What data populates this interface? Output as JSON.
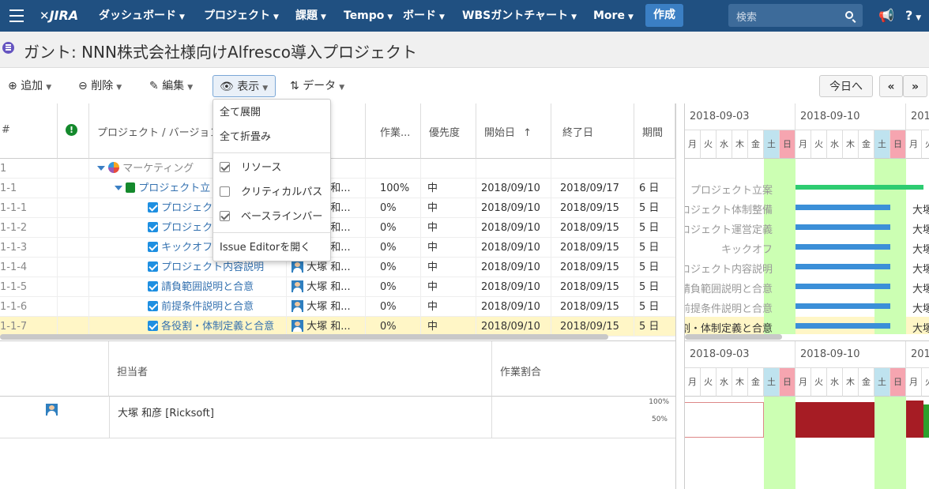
{
  "nav": {
    "logo": "JIRA",
    "items": [
      "ダッシュボード",
      "プロジェクト",
      "課題",
      "Tempo",
      "ボード",
      "WBSガントチャート",
      "More"
    ],
    "create": "作成",
    "search_placeholder": "検索"
  },
  "page": {
    "title": "ガント: NNN株式会社様向けAlfresco導入プロジェクト"
  },
  "toolbar": {
    "add": "追加",
    "delete": "削除",
    "edit": "編集",
    "view": "表示",
    "data": "データ",
    "today": "今日へ",
    "prev": "«",
    "next": "»"
  },
  "menu": {
    "expand_all": "全て展開",
    "collapse_all": "全て折畳み",
    "resource": "リソース",
    "critical_path": "クリティカルパス",
    "baseline": "ベースラインバー",
    "issue_editor": "Issue Editorを開く"
  },
  "grid": {
    "headers": {
      "id": "#",
      "project": "プロジェクト / バージョン",
      "work": "作業...",
      "priority": "優先度",
      "start": "開始日",
      "sort_arrow": "↑",
      "end": "終了日",
      "duration": "期間"
    },
    "rows": [
      {
        "id": "1",
        "name": "マーケティング",
        "assignee": "",
        "work": "",
        "priority": "",
        "start": "",
        "end": "",
        "duration": ""
      },
      {
        "id": "1-1",
        "name": "プロジェクト立",
        "assignee": "大塚 和...",
        "work": "100%",
        "priority": "中",
        "start": "2018/09/10",
        "end": "2018/09/17",
        "duration": "6 日"
      },
      {
        "id": "1-1-1",
        "name": "プロジェク",
        "assignee": "大塚 和...",
        "work": "0%",
        "priority": "中",
        "start": "2018/09/10",
        "end": "2018/09/15",
        "duration": "5 日"
      },
      {
        "id": "1-1-2",
        "name": "プロジェク",
        "assignee": "大塚 和...",
        "work": "0%",
        "priority": "中",
        "start": "2018/09/10",
        "end": "2018/09/15",
        "duration": "5 日"
      },
      {
        "id": "1-1-3",
        "name": "キックオフ",
        "assignee": "大塚 和...",
        "work": "0%",
        "priority": "中",
        "start": "2018/09/10",
        "end": "2018/09/15",
        "duration": "5 日"
      },
      {
        "id": "1-1-4",
        "name": "プロジェクト内容説明",
        "assignee": "大塚 和...",
        "work": "0%",
        "priority": "中",
        "start": "2018/09/10",
        "end": "2018/09/15",
        "duration": "5 日"
      },
      {
        "id": "1-1-5",
        "name": "請負範囲説明と合意",
        "assignee": "大塚 和...",
        "work": "0%",
        "priority": "中",
        "start": "2018/09/10",
        "end": "2018/09/15",
        "duration": "5 日"
      },
      {
        "id": "1-1-6",
        "name": "前提条件説明と合意",
        "assignee": "大塚 和...",
        "work": "0%",
        "priority": "中",
        "start": "2018/09/10",
        "end": "2018/09/15",
        "duration": "5 日"
      },
      {
        "id": "1-1-7",
        "name": "各役割・体制定義と合意",
        "assignee": "大塚 和...",
        "work": "0%",
        "priority": "中",
        "start": "2018/09/10",
        "end": "2018/09/15",
        "duration": "5 日"
      }
    ]
  },
  "gantt": {
    "weeks": [
      "2018-09-03",
      "2018-09-10",
      "201"
    ],
    "days": [
      "月",
      "火",
      "水",
      "木",
      "金",
      "土",
      "日",
      "月",
      "火",
      "水",
      "木",
      "金",
      "土",
      "日",
      "月",
      "火"
    ],
    "labels": [
      "プロジェクト立案",
      "ロジェクト体制整備",
      "ロジェクト運営定義",
      "キックオフ",
      "ロジェクト内容説明",
      "請負範囲説明と合意",
      "前提条件説明と合意",
      "割・体制定義と合意"
    ],
    "right_labels": [
      "大塚",
      "大塚",
      "大塚",
      "大塚",
      "大塚",
      "大塚",
      "大塚"
    ],
    "colors": {
      "summary": "#2ecc71",
      "task": "#3b8fd8",
      "saturday": "#bfe3ef",
      "sunday": "#f6a5b0",
      "weekend_bg": "#ccffb3",
      "load": "#a61c24"
    }
  },
  "resource": {
    "headers": {
      "assignee": "担当者",
      "ratio": "作業割合"
    },
    "name": "大塚 和彦 [Ricksoft]",
    "ticks": [
      "100%",
      "50%"
    ]
  }
}
